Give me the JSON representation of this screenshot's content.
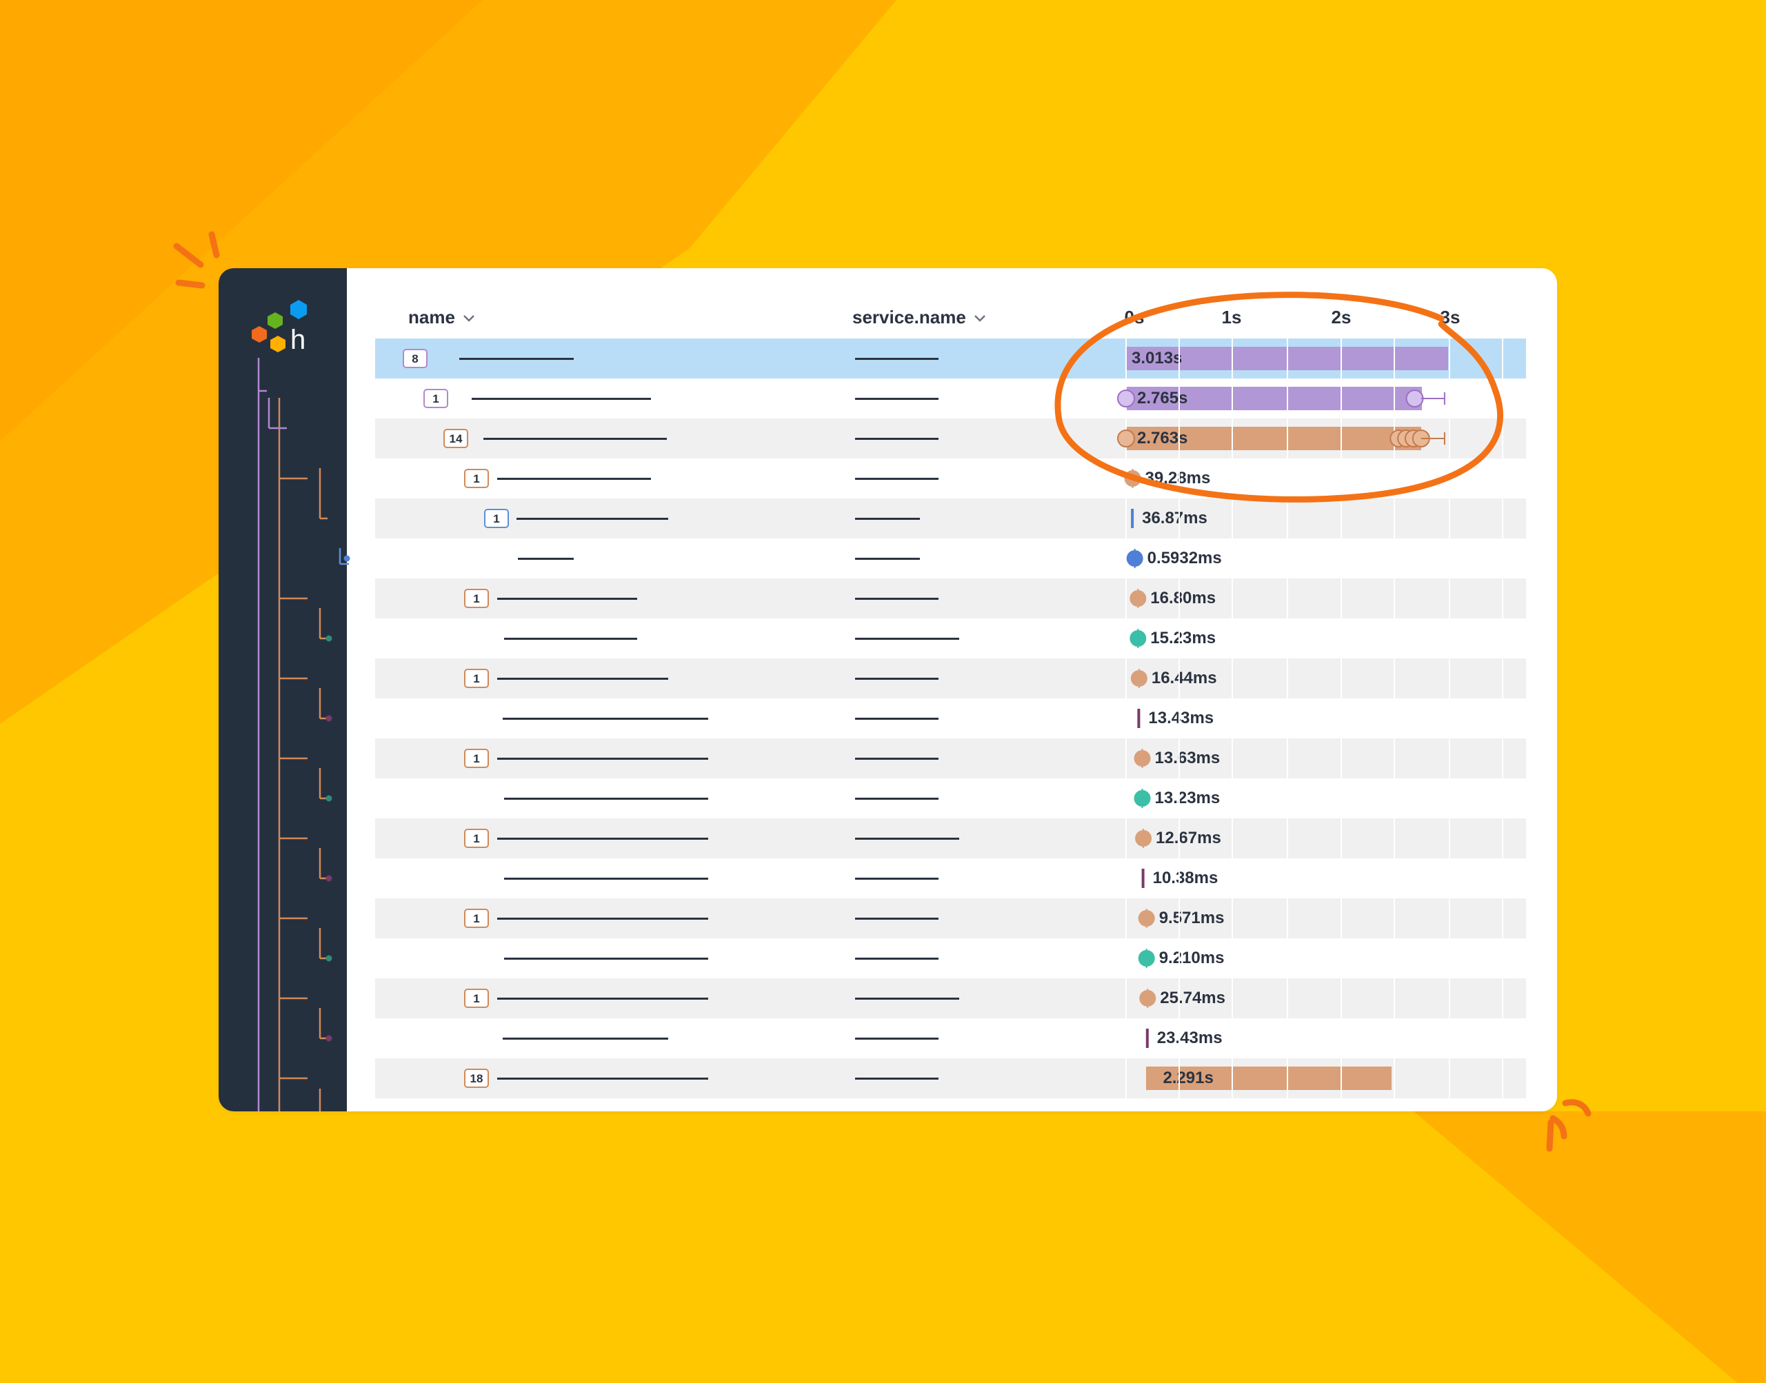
{
  "header": {
    "name_label": "name",
    "service_label": "service.name",
    "axis": [
      "0s",
      "1s",
      "2s",
      "3s"
    ]
  },
  "colors": {
    "background": "#FFC700",
    "background_accent": "#FFAF00",
    "sidebar": "#25303E",
    "selected_row": "#B9DDF6",
    "shaded_row": "#F0F0F0",
    "purple": "#B297D6",
    "orange": "#D9A07A",
    "teal": "#3BBFA6",
    "blue": "#4F7FD6",
    "maroon": "#7A3A6A",
    "highlight_ring": "#F47216"
  },
  "logo": {
    "icon_name": "honeycomb-logo",
    "letter": "h"
  },
  "rows": [
    {
      "badge": "8",
      "badge_color": "purple",
      "duration": "3.013s",
      "start_s": 0.0,
      "duration_s": 3.013,
      "color": "purple",
      "kind": "bar"
    },
    {
      "badge": "1",
      "badge_color": "purple",
      "duration": "2.765s",
      "start_s": 0.0,
      "duration_s": 2.765,
      "color": "purple",
      "kind": "bar"
    },
    {
      "badge": "14",
      "badge_color": "orange",
      "duration": "2.763s",
      "start_s": 0.0,
      "duration_s": 2.763,
      "color": "orange",
      "kind": "bar"
    },
    {
      "badge": "1",
      "badge_color": "orange",
      "duration": "39.28ms",
      "start_s": 0.01,
      "duration_s": 0.0393,
      "color": "orange",
      "kind": "dot"
    },
    {
      "badge": "1",
      "badge_color": "blue",
      "duration": "36.87ms",
      "start_s": 0.02,
      "duration_s": 0.0369,
      "color": "blue",
      "kind": "tick"
    },
    {
      "badge": "",
      "badge_color": "blue",
      "duration": "0.5932ms",
      "start_s": 0.03,
      "duration_s": 0.0006,
      "color": "blue",
      "kind": "dot"
    },
    {
      "badge": "1",
      "badge_color": "orange",
      "duration": "16.80ms",
      "start_s": 0.06,
      "duration_s": 0.0168,
      "color": "orange",
      "kind": "dot"
    },
    {
      "badge": "",
      "badge_color": "teal",
      "duration": "15.23ms",
      "start_s": 0.06,
      "duration_s": 0.0152,
      "color": "teal",
      "kind": "dot"
    },
    {
      "badge": "1",
      "badge_color": "orange",
      "duration": "16.44ms",
      "start_s": 0.07,
      "duration_s": 0.0164,
      "color": "orange",
      "kind": "dot"
    },
    {
      "badge": "",
      "badge_color": "maroon",
      "duration": "13.43ms",
      "start_s": 0.08,
      "duration_s": 0.0134,
      "color": "maroon",
      "kind": "tick"
    },
    {
      "badge": "1",
      "badge_color": "orange",
      "duration": "13.63ms",
      "start_s": 0.1,
      "duration_s": 0.0136,
      "color": "orange",
      "kind": "dot"
    },
    {
      "badge": "",
      "badge_color": "teal",
      "duration": "13.23ms",
      "start_s": 0.1,
      "duration_s": 0.0132,
      "color": "teal",
      "kind": "dot"
    },
    {
      "badge": "1",
      "badge_color": "orange",
      "duration": "12.67ms",
      "start_s": 0.11,
      "duration_s": 0.0127,
      "color": "orange",
      "kind": "dot"
    },
    {
      "badge": "",
      "badge_color": "maroon",
      "duration": "10.38ms",
      "start_s": 0.12,
      "duration_s": 0.0104,
      "color": "maroon",
      "kind": "tick"
    },
    {
      "badge": "1",
      "badge_color": "orange",
      "duration": "9.571ms",
      "start_s": 0.14,
      "duration_s": 0.0096,
      "color": "orange",
      "kind": "dot"
    },
    {
      "badge": "",
      "badge_color": "teal",
      "duration": "9.210ms",
      "start_s": 0.14,
      "duration_s": 0.0092,
      "color": "teal",
      "kind": "dot"
    },
    {
      "badge": "1",
      "badge_color": "orange",
      "duration": "25.74ms",
      "start_s": 0.15,
      "duration_s": 0.0257,
      "color": "orange",
      "kind": "dot"
    },
    {
      "badge": "",
      "badge_color": "maroon",
      "duration": "23.43ms",
      "start_s": 0.16,
      "duration_s": 0.0234,
      "color": "maroon",
      "kind": "tick"
    },
    {
      "badge": "18",
      "badge_color": "orange",
      "duration": "2.291s",
      "start_s": 0.19,
      "duration_s": 2.291,
      "color": "orange",
      "kind": "bar"
    }
  ]
}
